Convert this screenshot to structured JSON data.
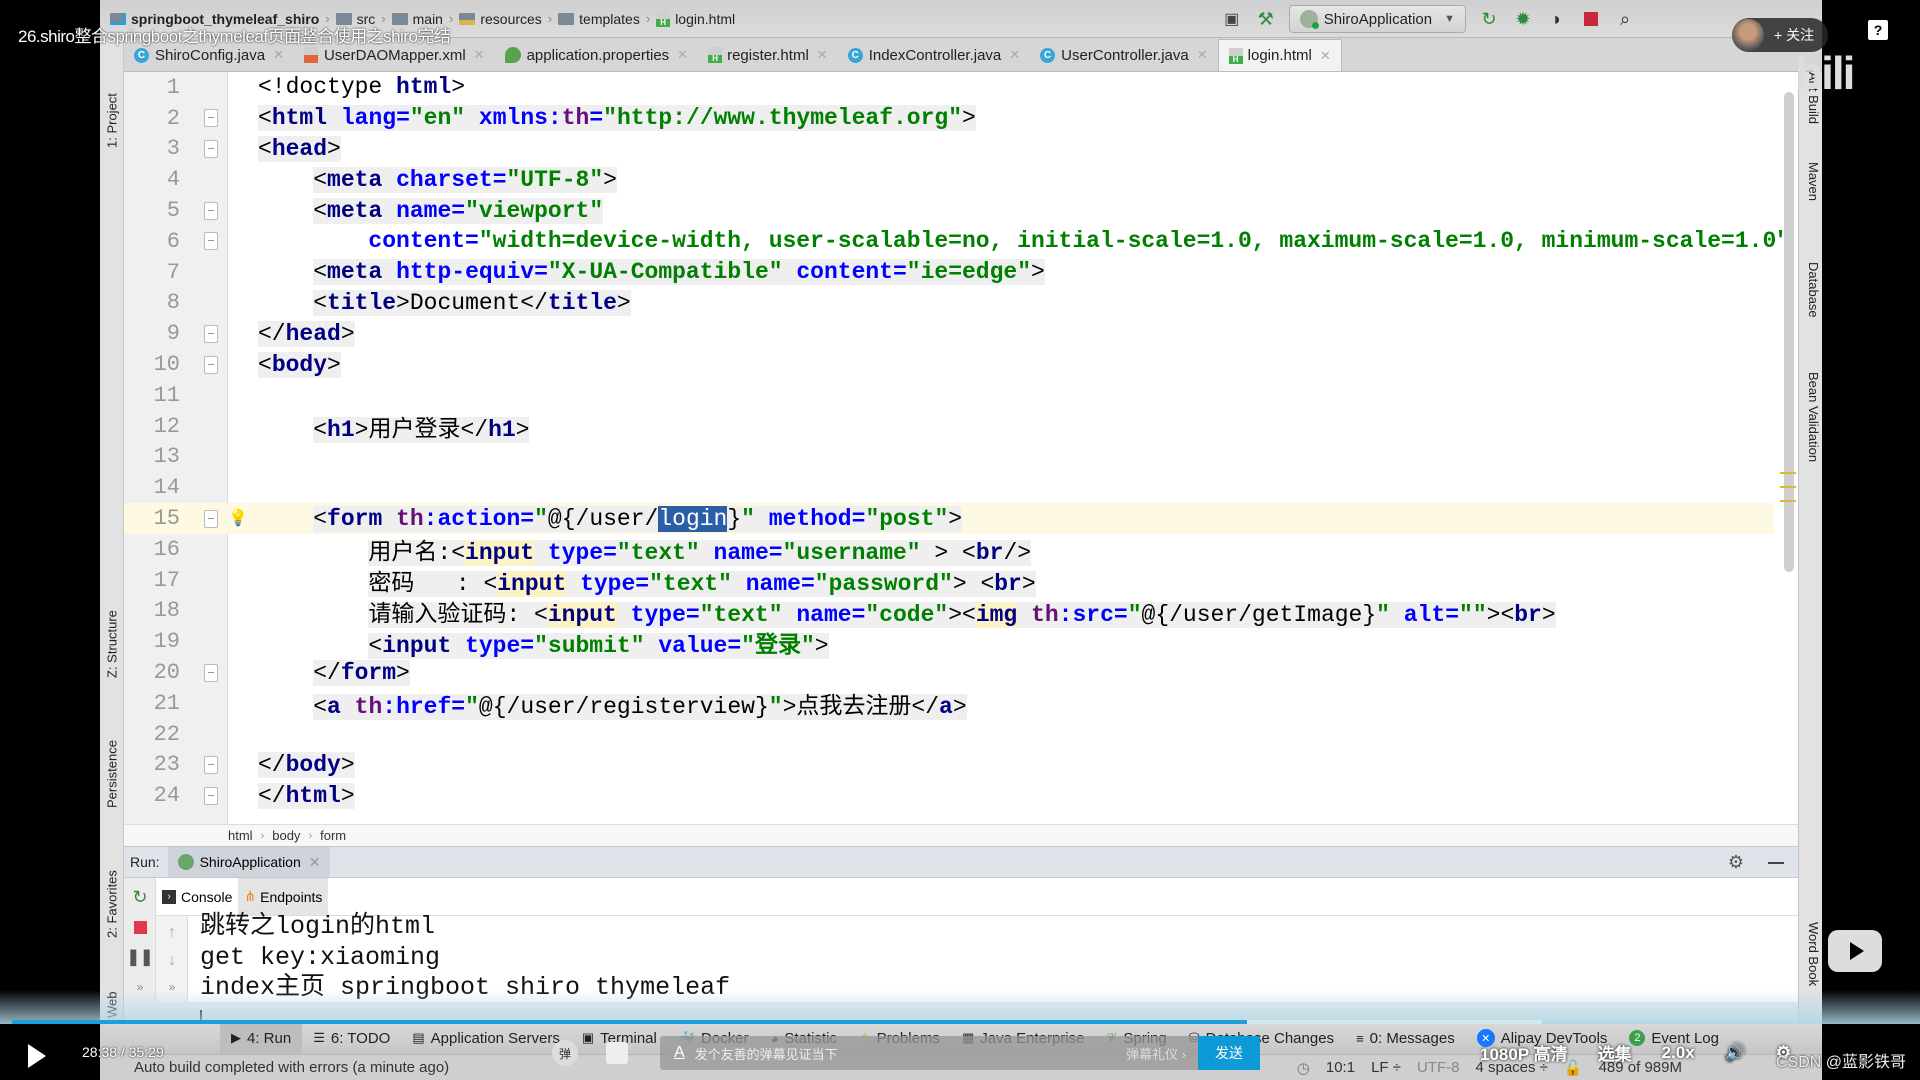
{
  "video": {
    "title": "26.shiro整合springboot之thymeleaf页面整合使用之shiro完结",
    "follow_label": "+ 关注",
    "help": "?",
    "logo": "bili",
    "time_current": "28:38",
    "time_total": "35:29",
    "time_display": "28:38 / 35:29",
    "progress": 0.807,
    "danmaku_placeholder": "发个友善的弹幕见证当下",
    "danmaku_etiquette": "弹幕礼仪 ›",
    "danmaku_send": "发送",
    "danmaku_toggle": "弹",
    "quality": "1080P 高清",
    "episodes": "选集",
    "speed": "2.0x",
    "watermark": "CSDN @蓝影铁哥"
  },
  "navbar": {
    "crumbs": [
      "springboot_thymeleaf_shiro",
      "src",
      "main",
      "resources",
      "templates",
      "login.html"
    ],
    "run_config": "ShiroApplication"
  },
  "tabs": [
    {
      "label": "ShiroConfig.java",
      "icon": "class"
    },
    {
      "label": "UserDAOMapper.xml",
      "icon": "xml"
    },
    {
      "label": "application.properties",
      "icon": "properties"
    },
    {
      "label": "register.html",
      "icon": "html"
    },
    {
      "label": "IndexController.java",
      "icon": "class"
    },
    {
      "label": "UserController.java",
      "icon": "class"
    },
    {
      "label": "login.html",
      "icon": "html",
      "active": true
    }
  ],
  "left_tools": [
    "1: Project",
    "Z: Structure",
    "Persistence",
    "2: Favorites",
    "Web"
  ],
  "right_tools": [
    "Ant Build",
    "Maven",
    "Database",
    "Bean Validation",
    "Word Book"
  ],
  "editor": {
    "current_line": 15,
    "lines": [
      {
        "n": "1"
      },
      {
        "n": "2"
      },
      {
        "n": "3"
      },
      {
        "n": "4"
      },
      {
        "n": "5"
      },
      {
        "n": "6"
      },
      {
        "n": "7"
      },
      {
        "n": "8"
      },
      {
        "n": "9"
      },
      {
        "n": "10"
      },
      {
        "n": "11"
      },
      {
        "n": "12"
      },
      {
        "n": "13"
      },
      {
        "n": "14"
      },
      {
        "n": "15"
      },
      {
        "n": "16"
      },
      {
        "n": "17"
      },
      {
        "n": "18"
      },
      {
        "n": "19"
      },
      {
        "n": "20"
      },
      {
        "n": "21"
      },
      {
        "n": "22"
      },
      {
        "n": "23"
      },
      {
        "n": "24"
      }
    ],
    "tokens": {
      "l1": [
        "<!doctype ",
        "html",
        ">"
      ],
      "l2": [
        "<",
        "html",
        " ",
        "lang",
        "=",
        "\"en\"",
        " ",
        "xmlns:",
        "th",
        "=",
        "\"http://www.thymeleaf.org\"",
        ">"
      ],
      "l3": [
        "<",
        "head",
        ">"
      ],
      "l4": [
        "<",
        "meta",
        " ",
        "charset",
        "=",
        "\"UTF-8\"",
        ">"
      ],
      "l5": [
        "<",
        "meta",
        " ",
        "name",
        "=",
        "\"viewport\""
      ],
      "l6": [
        "content",
        "=",
        "\"width=device-width, user-scalable=no, initial-scale=1.0, maximum-scale=1.0, minimum-scale=1.0\""
      ],
      "l7": [
        "<",
        "meta",
        " ",
        "http-equiv",
        "=",
        "\"X-UA-Compatible\"",
        " ",
        "content",
        "=",
        "\"ie=edge\"",
        ">"
      ],
      "l8": [
        "<",
        "title",
        ">",
        "Document",
        "</",
        "title",
        ">"
      ],
      "l9": [
        "</",
        "head",
        ">"
      ],
      "l10": [
        "<",
        "body",
        ">"
      ],
      "l12": [
        "<",
        "h1",
        ">",
        "用户登录",
        "</",
        "h1",
        ">"
      ],
      "l15": [
        "<",
        "form",
        " ",
        "th",
        ":action",
        "=",
        "\"",
        "@{/user/",
        "login",
        "}",
        "\"",
        " ",
        "method",
        "=",
        "\"post\"",
        ">"
      ],
      "l16": [
        "用户名:",
        "<",
        "input",
        " ",
        "type",
        "=",
        "\"text\"",
        " ",
        "name",
        "=",
        "\"username\"",
        " > ",
        "<",
        "br",
        "/>"
      ],
      "l17": [
        "密码   : ",
        "<",
        "input",
        " ",
        "type",
        "=",
        "\"text\"",
        " ",
        "name",
        "=",
        "\"password\"",
        ">",
        " ",
        "<",
        "br",
        ">"
      ],
      "l18": [
        "请输入验证码: ",
        "<",
        "input",
        " ",
        "type",
        "=",
        "\"text\"",
        " ",
        "name",
        "=",
        "\"code\"",
        ">",
        "<",
        "img",
        " ",
        "th",
        ":src",
        "=",
        "\"",
        "@{/user/getImage}",
        "\"",
        " ",
        "alt",
        "=",
        "\"\"",
        ">",
        "<",
        "br",
        ">"
      ],
      "l19": [
        "<",
        "input",
        " ",
        "type",
        "=",
        "\"submit\"",
        " ",
        "value",
        "=",
        "\"登录\"",
        ">"
      ],
      "l20": [
        "</",
        "form",
        ">"
      ],
      "l21": [
        "<",
        "a",
        " ",
        "th",
        ":href",
        "=",
        "\"",
        "@{/user/registerview}",
        "\"",
        ">",
        "点我去注册",
        "</",
        "a",
        ">"
      ],
      "l23": [
        "</",
        "body",
        ">"
      ],
      "l24": [
        "</",
        "html",
        ">"
      ]
    }
  },
  "breadcrumb": [
    "html",
    "body",
    "form"
  ],
  "run": {
    "label": "Run:",
    "tab": "ShiroApplication",
    "subtabs": [
      "Console",
      "Endpoints"
    ],
    "console_lines": [
      "跳转之login的html",
      "get key:xiaoming",
      "index主页 springboot shiro thymeleaf"
    ]
  },
  "toolwindows": [
    {
      "label": "4: Run",
      "icon": "run-icon",
      "active": true
    },
    {
      "label": "6: TODO",
      "icon": "todo-icon"
    },
    {
      "label": "Application Servers",
      "icon": "servers-icon"
    },
    {
      "label": "Terminal",
      "icon": "terminal-icon"
    },
    {
      "label": "Docker",
      "icon": "docker-icon"
    },
    {
      "label": "Statistic",
      "icon": "statistic-icon"
    },
    {
      "label": "Problems",
      "icon": "warning-icon"
    },
    {
      "label": "Java Enterprise",
      "icon": "javaee-icon"
    },
    {
      "label": "Spring",
      "icon": "spring-icon"
    },
    {
      "label": "Database Changes",
      "icon": "db-changes-icon"
    },
    {
      "label": "0: Messages",
      "icon": "messages-icon"
    },
    {
      "label": "Alipay DevTools",
      "icon": "alipay-icon"
    },
    {
      "label": "Event Log",
      "icon": "event-log-icon",
      "badge": "2"
    }
  ],
  "status": {
    "message": "Auto build completed with errors (a minute ago)",
    "position": "10:1",
    "line_sep": "LF ÷",
    "encoding": "UTF-8",
    "indent": "4 spaces ÷",
    "memory": "489 of 989M"
  },
  "colors": {
    "tag": "#000080",
    "attr": "#0000ff",
    "namespace": "#660e7a",
    "string": "#008000",
    "selection": "#2a5fa8",
    "current_line": "#fdf9e3",
    "progress": "#1e9fd8",
    "send_button": "#0e9ad6"
  }
}
